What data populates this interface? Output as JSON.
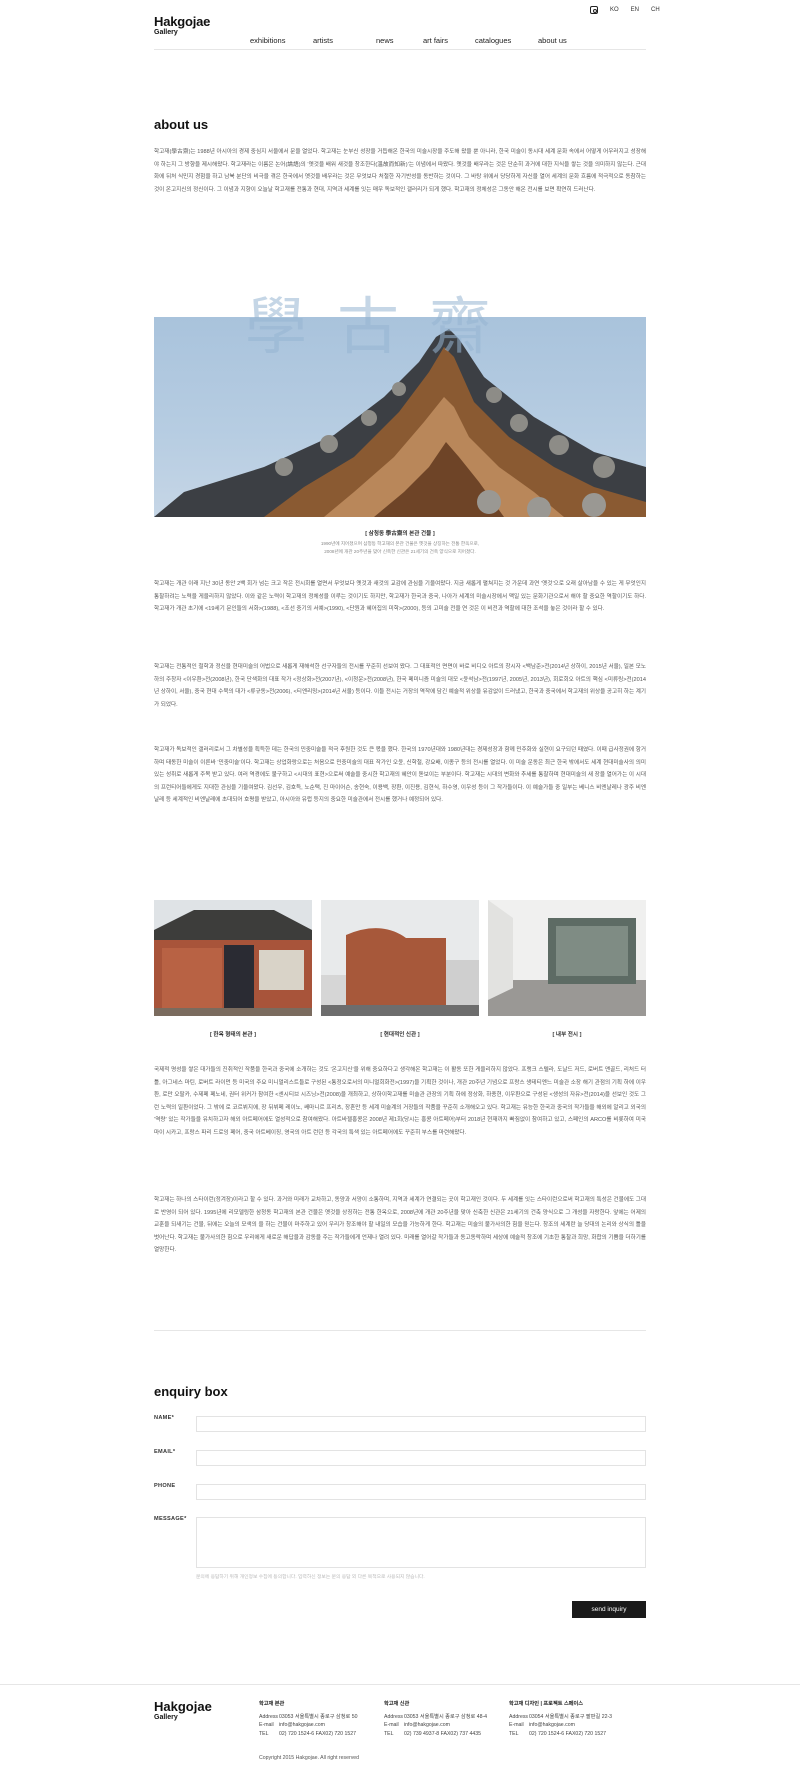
{
  "header": {
    "logo_name": "Hakgojae",
    "logo_sub": "Gallery",
    "langs": [
      "KO",
      "EN",
      "CH"
    ],
    "nav": [
      "exhibitions",
      "artists",
      "news",
      "art fairs",
      "catalogues",
      "about us"
    ]
  },
  "about": {
    "title": "about us",
    "intro": "학고재(學古齋)는 1988년 아시아의 경제 중심지 서울에서 문을 열었다. 학고재는 눈부신 성장을 거듭해온 한국의 미술시장을 주도해 왔을 뿐 아니라, 한국 미술이 동시대 세계 문화 속에서 어떻게 어우러지고 성장해야 하는지 그 방향을 제시해왔다. 학고재라는 이름은 논어(論語)의 ‘옛것을 배워 새것을 창조한다(溫故而知新)’는 이념에서 따왔다. 옛것을 배우라는 것은 단순히 과거에 대한 지식을 쌓는 것을 의미하지 않는다. 근대화에 뒤처 식민지 경험을 하고 남북 분단의 비극을 겪은 한국에서 옛것을 배우라는 것은 무엇보다 처절한 자기반성을 동반하는 것이다. 그 바탕 위에서 당당하게 자신을 열어 세계의 문화 흐름에 적극적으로 동참하는 것이 온고지신의 정신이다. 그 이념과 지향이 오늘날 학고재를 전통과 현대, 지역과 세계를 잇는 매우 독보적인 갤러리가 되게 했다. 학고재의 정체성은 그동안 해온 전시를 보면 확연히 드러난다.",
    "hero_chars": "學古齋",
    "caption_title": "[ 삼청동 學古齋의 본관 건물 ]",
    "caption_lines": [
      "1990년에 지어졌으며 삼청동 학고재의 본관 건물은 옛것을 상징하는 전통 한옥으로,",
      "2008년에 개관 20주년을 맞아 신축한 신관은 21세기의 건축 양식으로 지어졌다."
    ],
    "paragraphs": [
      "학고재는 개관 이래 지난 30년 동안 2백 회가 넘는 크고 작은 전시회를 열면서 무엇보다 옛것과 새것의 교감에 관심을 기울여왔다. 지금 새롭게 펼쳐지는 것 가운데 과연 ‘옛것’으로 오래 살아남을 수 있는 게 무엇인지 통찰하려는 노력을 게을리하지 않았다. 이와 같은 노력이 학고재의 정체성을 이루는 것이기도 하지만, 학고재가 한국과 중국, 나아가 세계의 미술시장에서 맥일 있는 문화기관으로서 해야 할 중요한 역할이기도 하다. 학고재가 개관 초기에 <19세기 문인들의 서화>(1988), <조선 중기의 서예>(1990), <단원과 혜어집의 미학>(2000), 등의 고미술 전을 연 것은 이 비전과 역할에 대한 조석을 놓은 것이라 할 수 있다.",
      "학고재는 전통적인 철학과 정신을 현대미술의 어법으로 새롭게 재해석한 선구자들의 전시를 꾸준히 선보여 왔다. 그 대표적인 면면이 바로 비디오 아트의 창시자 <백남준>전(2014년 상하이, 2015년 서울), 일본 모노하의 주창자 <이우환>전(2008년), 한국 단색화의 대표 작가 <정상화>전(2007년), <이청운>전(2008년), 한국 페미니즘 미술의 대모 <윤석남>전(1997년, 2005년, 2013년), 회로회오 아트의 핵심 <미류링>전(2014년 상하이, 서울), 중국 현대 수묵의 대가 <류규동>전(2006), <티엔리밍>(2014년 서울) 등이다. 이들 전시는 거장의 역작에 담긴 예술적 위상을 유감없이 드러냈고, 한국과 중국에서 학고재의 위상을 공고히 하는 계기가 되었다.",
      "학고재가 독보적인 갤러리로서 그 차별성을 획득한 데는 한국의 민중미술을 적극 후원한 것도 큰 몫을 했다. 한국의 1970년대와 1980년대는 경제성장과 함께 민주화와 실현이 요구되던 때였다. 이때 급사정권에 항거하며 태동한 미술이 이른바 ‘민중미술’이다. 학고재는 상업화랑으로는 처음으로 민중미술의 대표 작가인 오윤, 신학철, 강요배, 이종구 등의 전시를 열었다. 이 미술 운동은 최근 한국 밖에서도 세계 현대미술사의 의미 있는 성취로 새롭게 주목 받고 있다. 여러 역경에도 불구하고 <시대의 표현>으로써 예술을 중시한 학고재의 혜안이 돋보이는 부분이다. 학고재는 시대의 변화와 추세를 통찰하며 현대미술의 새 장을 열어가는 이 시대의 프런티어들에게도 지대한 관심을 기울여왔다. 김선우, 김호득, 노순택, 진 마이어슨, 송현숙, 이용백, 장환, 이진용, 김현식, 하수영, 이우성 등이 그 작가들이다. 이 예술가들 중 일부는 베니스 비엔날레나 광주 비엔날레 등 세계적인 비엔날레에 초대되어 호평을 받았고, 아시아와 유럽 등지의 중요한 미술관에서 전시를 했거나 예정되어 있다.",
      "국제적 명성을 쌓은 대가들의 진취적인 작품을 한국과 중국에 소개하는 것도 ‘온고지신’을 위해 중요하다고 생각해온 학고재는 이 활동 또한 게을리하지 않았다. 프랭크 스텔라, 도날드 저드, 로버트 맨골드, 리처드 터틀, 아그네스 마틴, 로버트 라이먼 등 미국의 주요 미니멀리스트들로 구성된 <통정오로서의 미니멀회화전>(1997)을 기획한 것이나, 개관 20주년 기념으로 프랑스 생테티엔느 미술관 소장 해기 관점의 기획 하에 이우환, 로만 오팔카, 수제페 페노네, 권터 위커가 참여한 <센시티브 시즈닝>전(2008)을 개최하고, 상하이학고재를 미술관 관장의 기획 하에 정상화, 하종현, 이우환으로 구성된 <생성의 자유>전(2014)을 선보인 것도 그런 노력의 일환이었다. 그 밖에 로 코르뷔지에, 장 뒤뷔페 레이노, 쌔마니르 프리츠, 장혼만 등 세계 미술계의 거장들의 작품을 꾸준히 소개해오고 있다. 학고재는 유능한 한국과 중국의 작가들을 해외에 알리고 외국의 ‘역량’ 있는 작가들을 유치하고자 해외 아트페어에도 열성적으로 참여해왔다. 아트바젤홍콩은 2008년 제1회(당시는 홍콩 아트페어)부터 2018년 현재까지 빠짐없이 참여하고 있고, 스페인의 ARCO를 비롯하여 미국 마이 시카고, 프랑스 파리 드로잉 페어, 중국 아트베이징, 영국의 아트 런던 등 각국의 특색 있는 아트페어에도 꾸준히 부스를 마련해왔다.",
      "학고재는 하나의 스타이런(정겨장)이라고 할 수 있다. 과거와 미래가 교차하고, 동양과 서양이 소통하며, 지역과 세계가 연결되는 곳이 학고재인 것이다. 두 세계를 잇는 스타이런으로써 학고재의 특성은 건물에도 그대로 반영이 되어 있다. 1995년에 리모델링한 삼청동 학고재의 본관 건물은 옛것을 상징하는 전통 한옥으로, 2008년에 개관 20주년을 맞아 신축한 신관은 21세기의 건축 양식으로 그 개성을 자랑한다. 앞에는 어제의 교훈을 되새기는 건물, 뒤에는 오늘의 모색의 을 하는 건물이 마주하고 있어 우리가 창조해야 할 내일의 모습을 가능하게 한다. 학고재는 미술의 불가사의한 힘을 믿는다. 창조의 세계란 늘 당대의 논리와 상식의 틀을 벗어난다. 학고재는 불가사의한 힘으로 우리에게 새로운 해답을과 감동을 주는 작가들에게 언제나 열려 있다. 미래를 열어갈 작가들과 동고동락하며 세상에 예술적 창조에 기초한 통찰과 희망, 화합의 기쁨을 더하기를 열망한다."
    ],
    "gallery_captions": [
      "[ 한옥 형태의 본관 ]",
      "[ 현대적인 신관 ]",
      "[ 내부 전시 ]"
    ]
  },
  "enquiry": {
    "title": "enquiry box",
    "name_label": "NAME*",
    "email_label": "EMAIL*",
    "phone_label": "PHONE",
    "message_label": "MESSAGE*",
    "privacy_note": "문의에 응답하기 위해 개인정보 수집에 동의합니다. 입력하신 정보는 문의 응답 외 다른 목적으로 사용되지 않습니다.",
    "send_label": "send inquiry"
  },
  "footer": {
    "logo_name": "Hakgojae",
    "logo_sub": "Gallery",
    "columns": [
      {
        "title": "학고재 본관",
        "address": "03053 서울특별시 종로구 삼청로 50",
        "email": "info@hakgojae.com",
        "tel": "02) 720 1524-6 FAX02) 720 1527"
      },
      {
        "title": "학고재 신관",
        "address": "03053 서울특별시 종로구 삼청로 48-4",
        "email": "info@hakgojae.com",
        "tel": "02) 739 4937-8 FAX02) 737 4435"
      },
      {
        "title": "학고재 디자인 | 프로젝트 스페이스",
        "address": "03054 서울특별시 종로구 팔판길 22-3",
        "email": "info@hakgojae.com",
        "tel": "02) 720 1524-6 FAX02) 720 1527"
      }
    ],
    "row_labels": {
      "address": "Address",
      "email": "E-mail",
      "tel": "TEL"
    },
    "copyright": "Copyright 2015 Hakgojae. All right reserved"
  }
}
